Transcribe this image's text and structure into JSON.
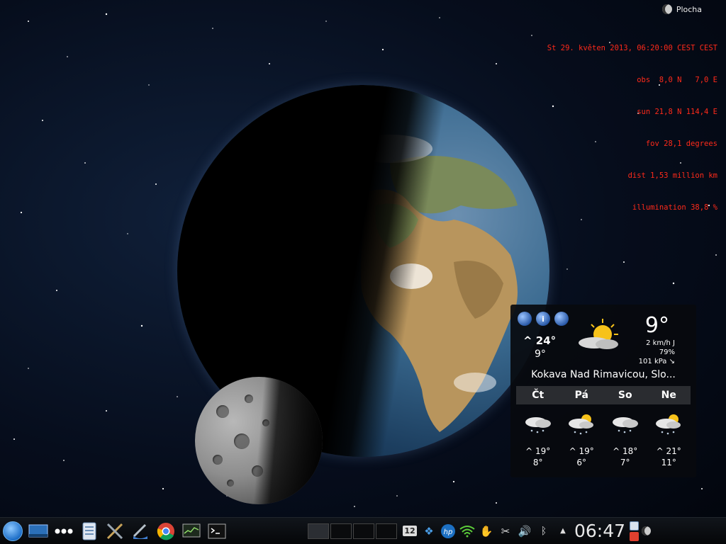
{
  "activity": {
    "label": "Plocha"
  },
  "xplanet": {
    "lines": [
      "St 29. květen 2013, 06:20:00 CEST CEST",
      "obs  8,0 N   7,0 E",
      "sun 21,8 N 114,4 E",
      "fov 28,1 degrees",
      "dist 1,53 million km",
      "illumination 38,8 %"
    ]
  },
  "weather": {
    "tabs": [
      "globe-icon",
      "info-icon",
      "globe-icon"
    ],
    "today_high": "^ 24°",
    "today_low": "9°",
    "current_temp": "9°",
    "wind": "2 km/h J",
    "humidity": "79%",
    "pressure": "101 kPa ↘",
    "location": "Kokava Nad Rimavicou, Slo...",
    "days": [
      {
        "name": "Čt",
        "icon": "cloud-snow-icon",
        "high": "^ 19°",
        "low": "8°"
      },
      {
        "name": "Pá",
        "icon": "sun-cloud-snow-icon",
        "high": "^ 19°",
        "low": "6°"
      },
      {
        "name": "So",
        "icon": "cloud-snow-icon",
        "high": "^ 18°",
        "low": "7°"
      },
      {
        "name": "Ne",
        "icon": "sun-cloud-snow-icon",
        "high": "^ 21°",
        "low": "11°"
      }
    ]
  },
  "taskbar": {
    "launchers": [
      "kde-menu-icon",
      "desktop-icon",
      "more-icon",
      "file-manager-icon",
      "tools-icon",
      "settings-icon",
      "chrome-icon",
      "system-monitor-icon",
      "terminal-icon"
    ],
    "calendar_day": "12",
    "clock": "06:47",
    "colors": {
      "accent": "#1e6fc8",
      "xplanet_text": "#ff2a1a"
    }
  }
}
